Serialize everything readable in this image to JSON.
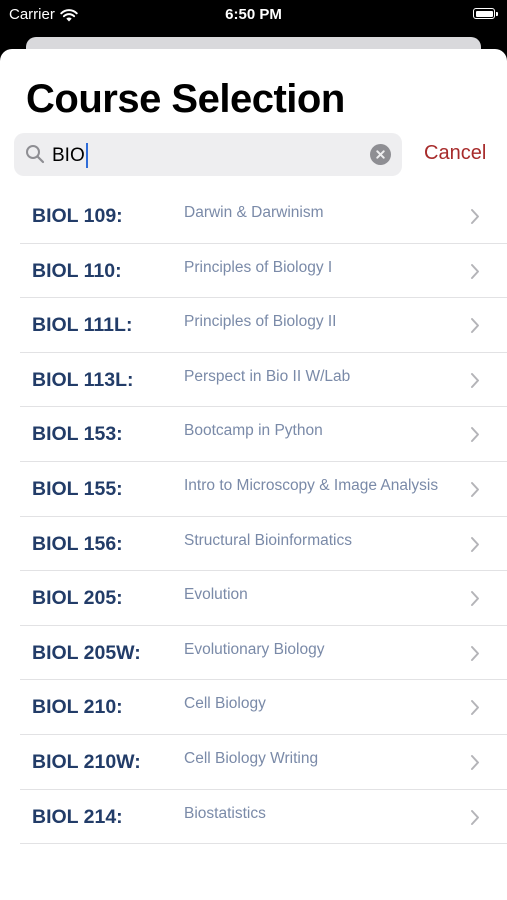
{
  "status_bar": {
    "carrier": "Carrier",
    "time": "6:50 PM"
  },
  "header": {
    "title": "Course Selection"
  },
  "search": {
    "value": "BIO",
    "cancel_label": "Cancel"
  },
  "courses": [
    {
      "code": "BIOL 109:",
      "name": "Darwin & Darwinism"
    },
    {
      "code": "BIOL 110:",
      "name": "Principles of Biology I"
    },
    {
      "code": "BIOL 111L:",
      "name": "Principles of Biology II"
    },
    {
      "code": "BIOL 113L:",
      "name": "Perspect in Bio II W/Lab"
    },
    {
      "code": "BIOL 153:",
      "name": "Bootcamp in Python"
    },
    {
      "code": "BIOL 155:",
      "name": "Intro to Microscopy & Image Analysis"
    },
    {
      "code": "BIOL 156:",
      "name": "Structural Bioinformatics"
    },
    {
      "code": "BIOL 205:",
      "name": "Evolution"
    },
    {
      "code": "BIOL 205W:",
      "name": "Evolutionary Biology"
    },
    {
      "code": "BIOL 210:",
      "name": "Cell Biology"
    },
    {
      "code": "BIOL 210W:",
      "name": "Cell Biology Writing"
    },
    {
      "code": "BIOL 214:",
      "name": "Biostatistics"
    }
  ],
  "colors": {
    "accent": "#a72b2b",
    "course_code": "#223c68",
    "course_name": "#7a8aa8"
  },
  "icons": [
    "wifi-icon",
    "battery-icon",
    "search-icon",
    "clear-icon",
    "chevron-right-icon"
  ]
}
